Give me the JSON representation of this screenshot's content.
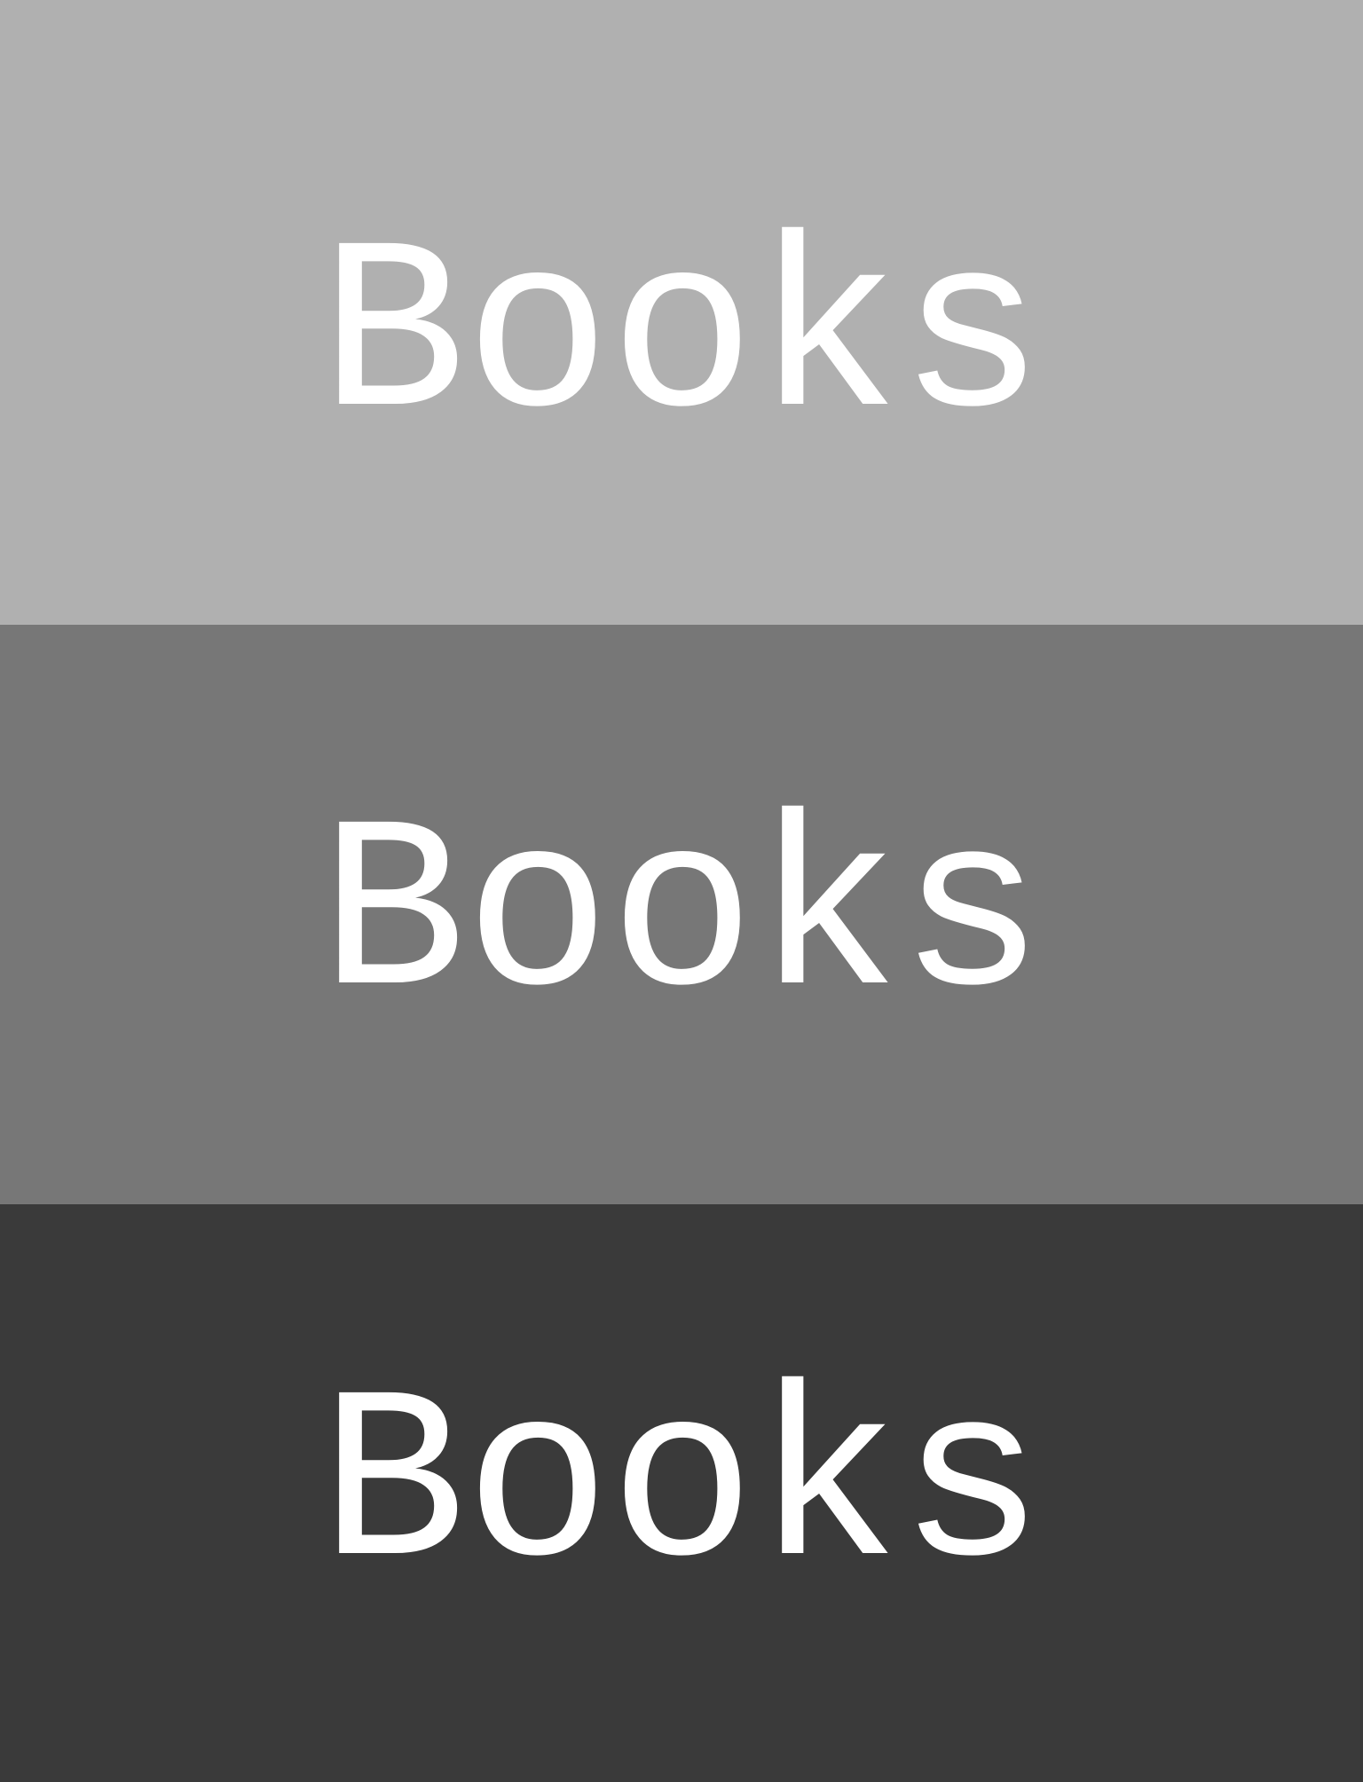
{
  "panels": [
    {
      "label": "Books",
      "background": "#b0b0b0"
    },
    {
      "label": "Books",
      "background": "#777777"
    },
    {
      "label": "Books",
      "background": "#3a3a3a"
    }
  ],
  "text_color": "#ffffff"
}
